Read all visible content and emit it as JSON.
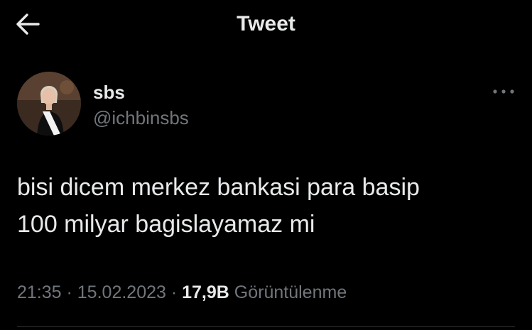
{
  "header": {
    "title": "Tweet",
    "back_icon": "arrow-left-icon"
  },
  "author": {
    "display_name": "sbs",
    "handle": "@ichbinsbs",
    "avatar_icon": "profile-photo",
    "more_icon": "more-horizontal-icon"
  },
  "tweet": {
    "text": "bisi dicem merkez bankasi para basip\n100 milyar bagislayamaz mi"
  },
  "meta": {
    "time": "21:35",
    "separator": " · ",
    "date": "15.02.2023",
    "views_count": "17,9B",
    "views_label": "Görüntülenme"
  },
  "colors": {
    "background": "#000000",
    "primary_text": "#e7e9ea",
    "secondary_text": "#71767b",
    "divider": "#2f3336"
  }
}
